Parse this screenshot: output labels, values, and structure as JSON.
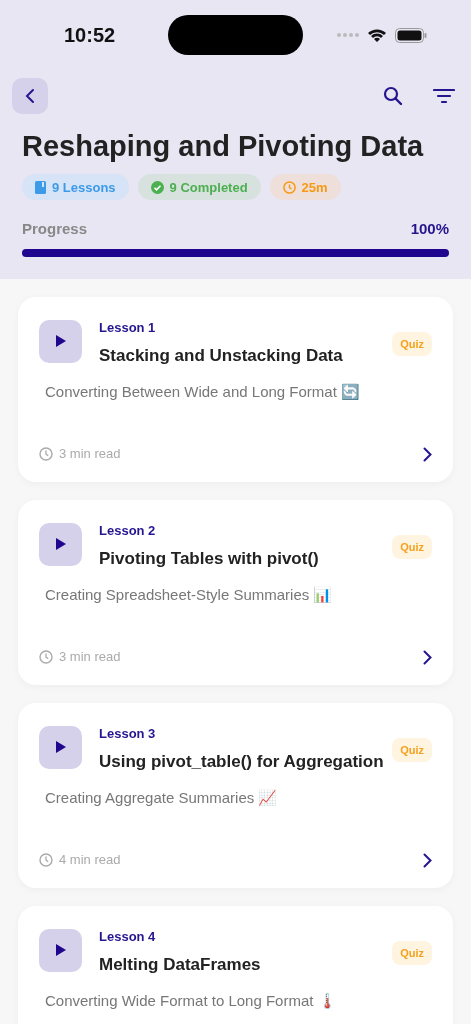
{
  "status_bar": {
    "time": "10:52"
  },
  "header": {
    "title": "Reshaping and Pivoting Data",
    "chips": [
      {
        "kind": "lessons",
        "label": "9 Lessons"
      },
      {
        "kind": "completed",
        "label": "9 Completed"
      },
      {
        "kind": "duration",
        "label": "25m"
      }
    ],
    "progress": {
      "label": "Progress",
      "reading": "100%",
      "level": 1
    }
  },
  "lessons": [
    {
      "number": "Lesson 1",
      "title": "Stacking and Unstacking Data",
      "subtitle": "Converting Between Wide and Long Format 🔄",
      "read_time": "3 min read",
      "badge": "Quiz"
    },
    {
      "number": "Lesson 2",
      "title": "Pivoting Tables with pivot()",
      "subtitle": "Creating Spreadsheet-Style Summaries 📊",
      "read_time": "3 min read",
      "badge": "Quiz"
    },
    {
      "number": "Lesson 3",
      "title": "Using pivot_table() for Aggregation",
      "subtitle": "Creating Aggregate Summaries 📈",
      "read_time": "4 min read",
      "badge": "Quiz"
    },
    {
      "number": "Lesson 4",
      "title": "Melting DataFrames",
      "subtitle": "Converting Wide Format to Long Format 🌡️",
      "badge": "Quiz"
    }
  ]
}
